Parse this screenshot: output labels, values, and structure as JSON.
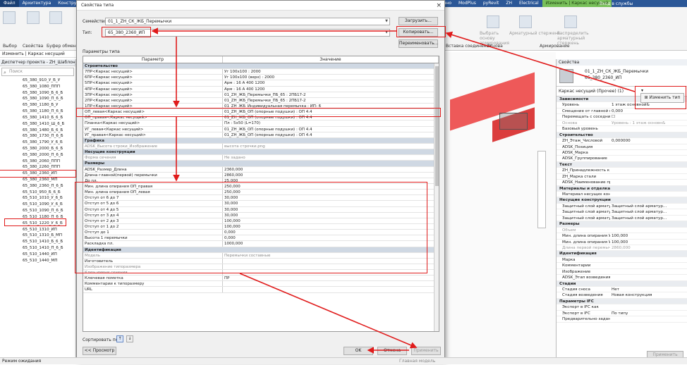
{
  "ribbon": {
    "tabs": [
      "Файл",
      "Архитектура",
      "Конструкция",
      "Железно",
      "ModPlus",
      "pyRevit",
      "ZH",
      "Electrical",
      "Изменить | Каркас несущий"
    ],
    "help_text": "Вход в службы",
    "left_buttons": [
      "Выбор",
      "Свойства",
      "Буфер обмен"
    ],
    "right_groups": [
      "Вставка соединения",
      "Основа",
      "Армирование"
    ],
    "right_buttons": [
      "Выбрать основу армирования",
      "Арматурный стержень",
      "Распределить арматурный стержень"
    ],
    "context_label": "Изменить | Каркас несущий"
  },
  "browser": {
    "title": "Диспетчер проекта - ZH_Шаблон_ЭП_...",
    "search_placeholder": "Поиск",
    "items": [
      "65_380_910_У_Б_У",
      "65_380_1080_ППП",
      "65_380_1090_Б_6_Б",
      "65_380_1090_П_6_Б",
      "65_380_1180_Б_У",
      "65_380_1180_П_6_Б",
      "65_380_1410_Б_6_Б",
      "65_380_1410_Ш_6_Б",
      "65_380_1480_Б_6_Б",
      "65_380_1730_П_6_Б",
      "65_380_1790_У_6_Б",
      "65_380_2000_Б_6_Б",
      "65_380_2000_П_6_Б",
      "65_380_2060_ППП",
      "65_380_2260_ППП",
      "65_380_2360_ИП",
      "65_380_2360_МП",
      "65_380_2360_П_6_Б",
      "65_510_950_Б_6_Б",
      "65_510_1010_У_6_Б",
      "65_510_1090_У_6_Б",
      "65_510_1090_П_6_Б",
      "65_510_1180_П_6_Б",
      "65_510_1220_У_6_Б",
      "65_510_1310_ИП",
      "65_510_1310_Б_МП",
      "65_510_1410_Б_6_Б",
      "65_510_1410_П_6_Б",
      "65_510_1440_ИП",
      "65_510_1440_МП"
    ],
    "selected_index": 15
  },
  "statusbar": {
    "left": "Режим ожидания",
    "mid": "Главная модель"
  },
  "dialog": {
    "title": "Свойства типа",
    "family_label": "Семейство:",
    "family_value": "01_1_ZH_СК_ЖБ_Перемычки",
    "type_label": "Тип:",
    "type_value": "65_380_2360_ИП",
    "load_btn": "Загрузить...",
    "copy_btn": "Копировать...",
    "rename_btn": "Переименовать...",
    "params_label": "Параметры типа",
    "col_param": "Параметр",
    "col_value": "Значение",
    "rows": [
      {
        "g": true,
        "p": "Строительство"
      },
      {
        "p": "7ПР<Каркас несущий>",
        "v": "Уг 100x100 : 2000"
      },
      {
        "p": "6ПР<Каркас несущий>",
        "v": "Уг 100x100 (верх) : 2000"
      },
      {
        "p": "5ПР<Каркас несущий>",
        "v": "Арм : 16 А 400 1200"
      },
      {
        "p": "4ПР<Каркас несущий>",
        "v": "Арм : 16 А 400 1200"
      },
      {
        "p": "3ПР<Каркас несущий>",
        "v": "01_ZH_ЖБ_Перемычки_ПБ_65 : 2ПБ17-2"
      },
      {
        "p": "2ПР<Каркас несущий>",
        "v": "01_ZH_ЖБ_Перемычки_ПБ_65 : 2ПБ17-2"
      },
      {
        "p": "1ПР<Каркас несущий>",
        "v": "01_ZH_ЖБ_Индивидуальная перемычка : ИП- 6"
      },
      {
        "p": "ОП_левая<Каркас несущий>",
        "v": "01_ZH_ЖБ_ОП (опорные подушки) : ОП 4.4"
      },
      {
        "p": "ОП_правая<Каркас несущий>",
        "v": "01_ZH_ЖБ_ОП (опорные подушки) : ОП 4.4"
      },
      {
        "p": "Планка<Каркас несущий>",
        "v": "Пл : 5x50 (L=170)"
      },
      {
        "p": "УГ_левая<Каркас несущий>",
        "v": "01_ZH_ЖБ_ОП (опорные подушки) : ОП 4.4"
      },
      {
        "p": "УГ_правая<Каркас несущий>",
        "v": "01_ZH_ЖБ_ОП (опорные подушки) : ОП 4.4"
      },
      {
        "g": true,
        "p": "Графика"
      },
      {
        "p": "ADSK_Высота строки_Изображение",
        "v": "высота строчки.png",
        "d": true
      },
      {
        "g": true,
        "p": "Несущие конструкции"
      },
      {
        "p": "Форма сечения",
        "v": "Не задано",
        "d": true
      },
      {
        "g": true,
        "p": "Размеры"
      },
      {
        "p": "ADSK_Размер_Длина",
        "v": "2360,000"
      },
      {
        "p": "Длина главной(первой) перемычки",
        "v": "2860,000"
      },
      {
        "p": "До пл.",
        "v": "25,000"
      },
      {
        "p": "Мин. длина опирания ОП_правая",
        "v": "250,000"
      },
      {
        "p": "Мин. длина опирания ОП_левая",
        "v": "250,000"
      },
      {
        "p": "Отступ от 6 до 7",
        "v": "30,000"
      },
      {
        "p": "Отступ от 5 до 6",
        "v": "30,000"
      },
      {
        "p": "Отступ от 4 до 5",
        "v": "30,000"
      },
      {
        "p": "Отступ от 3 до 4",
        "v": "30,000"
      },
      {
        "p": "Отступ от 2 до 3",
        "v": "100,000"
      },
      {
        "p": "Отступ от 1 до 2",
        "v": "100,000"
      },
      {
        "p": "Отступ до 1",
        "v": "0,000"
      },
      {
        "p": "Высота 1 перемычки",
        "v": "0,000"
      },
      {
        "p": "Раскладка пл.",
        "v": "1000,000"
      },
      {
        "g": true,
        "p": "Идентификация"
      },
      {
        "p": "Модель",
        "v": "Перемычки составные",
        "d": true
      },
      {
        "p": "Изготовитель",
        "v": ""
      },
      {
        "p": "Изображение типоразмера",
        "v": "",
        "d": true
      },
      {
        "p": "Ключ имени сечения",
        "v": "",
        "d": true
      },
      {
        "p": "Ключевая пометка",
        "v": "ПР"
      },
      {
        "p": "Комментарии к типоразмеру",
        "v": ""
      },
      {
        "p": "URL",
        "v": ""
      }
    ],
    "sort_label": "Сортировать по:",
    "preview_btn": "<< Просмотр",
    "ok_btn": "OK",
    "cancel_btn": "Отмена",
    "apply_btn": "Применить"
  },
  "props": {
    "title": "Свойства",
    "family": "01_1_ZH_СК_ЖБ_Перемычки",
    "type": "65_380_2360_ИП",
    "filter": "Каркас несущий (Прочее) (1)",
    "edit_type_btn": "Изменить тип",
    "rows": [
      {
        "g": true,
        "k": "Зависимости"
      },
      {
        "k": "Уровень",
        "v": "1 этаж основной&"
      },
      {
        "k": "Смещение от главной м...",
        "v": "0,000"
      },
      {
        "k": "Перемещать с соседни...",
        "v": "☐"
      },
      {
        "k": "Основа",
        "v": "Уровень : 1 этаж основн&",
        "d": true
      },
      {
        "k": "Базовый уровень",
        "v": ""
      },
      {
        "g": true,
        "k": "Строительство"
      },
      {
        "k": "ZH_Этаж_Числовой",
        "v": "0,000000"
      },
      {
        "k": "ADSK_Позиция",
        "v": ""
      },
      {
        "k": "ADSK_Марка",
        "v": ""
      },
      {
        "k": "ADSK_Группирование",
        "v": ""
      },
      {
        "g": true,
        "k": "Текст"
      },
      {
        "k": "ZH_Принадлежность к к...",
        "v": ""
      },
      {
        "k": "ZH_Марка стали",
        "v": ""
      },
      {
        "k": "ADSK_Наименование пр...",
        "v": ""
      },
      {
        "g": true,
        "k": "Материалы и отделка"
      },
      {
        "k": "Материал несущих конс...",
        "v": ""
      },
      {
        "g": true,
        "k": "Несущие конструкции"
      },
      {
        "k": "Защитный слой арматур...",
        "v": "Защитный слой арматур..."
      },
      {
        "k": "Защитный слой арматур...",
        "v": "Защитный слой арматур..."
      },
      {
        "k": "Защитный слой арматур...",
        "v": "Защитный слой арматур..."
      },
      {
        "g": true,
        "k": "Размеры"
      },
      {
        "k": "Объем",
        "v": "",
        "d": true
      },
      {
        "k": "Мин. длина опирания У...",
        "v": "100,000"
      },
      {
        "k": "Мин. длина опирания У...",
        "v": "100,000"
      },
      {
        "k": "Длина первой перемычки",
        "v": "2860,000",
        "d": true
      },
      {
        "g": true,
        "k": "Идентификация"
      },
      {
        "k": "Марка",
        "v": ""
      },
      {
        "k": "Комментарии",
        "v": ""
      },
      {
        "k": "Изображение",
        "v": ""
      },
      {
        "k": "ADSK_Этап возведения",
        "v": ""
      },
      {
        "g": true,
        "k": "Стадии"
      },
      {
        "k": "Стадия сноса",
        "v": "Нет"
      },
      {
        "k": "Стадия возведения",
        "v": "Новая конструкция"
      },
      {
        "g": true,
        "k": "Параметры IFC"
      },
      {
        "k": "Экспорт в IFC как",
        "v": ""
      },
      {
        "k": "Экспорт в IFC",
        "v": "По типу"
      },
      {
        "k": "Предварительно заданн...",
        "v": ""
      }
    ],
    "apply_btn": "Применить"
  }
}
